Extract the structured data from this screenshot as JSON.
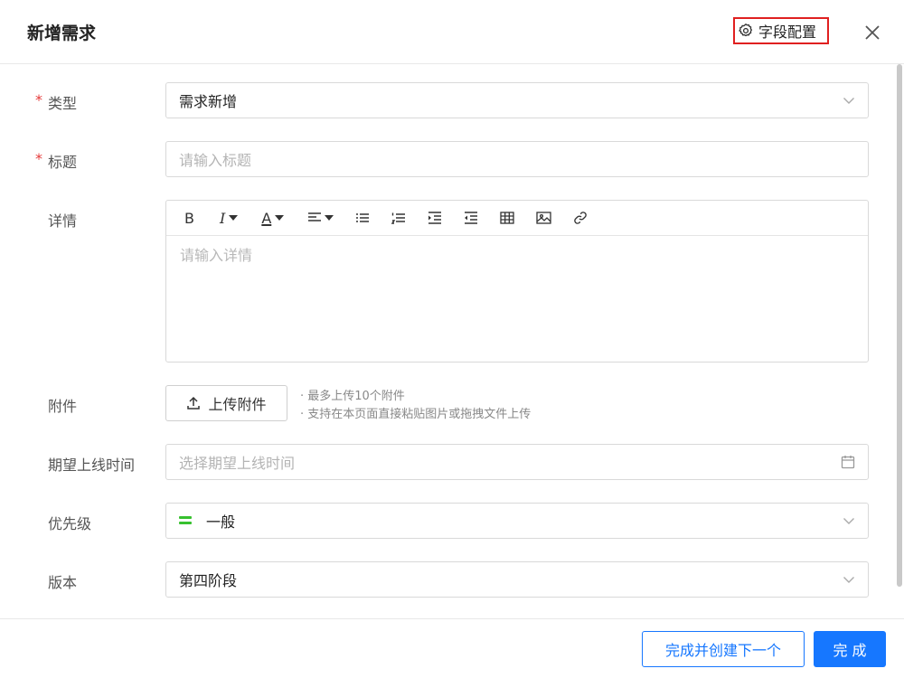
{
  "dialog": {
    "title": "新增需求",
    "field_config_label": "字段配置"
  },
  "form": {
    "type": {
      "label": "类型",
      "required_mark": "*",
      "value": "需求新增"
    },
    "title": {
      "label": "标题",
      "required_mark": "*",
      "placeholder": "请输入标题"
    },
    "details": {
      "label": "详情",
      "placeholder": "请输入详情",
      "toolbar": {
        "bold": "B",
        "italic": "I",
        "font_color": "A"
      }
    },
    "attachment": {
      "label": "附件",
      "upload_label": "上传附件",
      "hints": [
        "· 最多上传10个附件",
        "· 支持在本页面直接粘贴图片或拖拽文件上传"
      ]
    },
    "expected_time": {
      "label": "期望上线时间",
      "placeholder": "选择期望上线时间"
    },
    "priority": {
      "label": "优先级",
      "value": "一般",
      "color": "#37c12f"
    },
    "version": {
      "label": "版本",
      "value": "第四阶段"
    }
  },
  "footer": {
    "complete_and_next_label": "完成并创建下一个",
    "complete_label": "完 成"
  },
  "colors": {
    "primary": "#1677ff",
    "required": "#e53a3a",
    "highlight_box": "#e02020"
  }
}
